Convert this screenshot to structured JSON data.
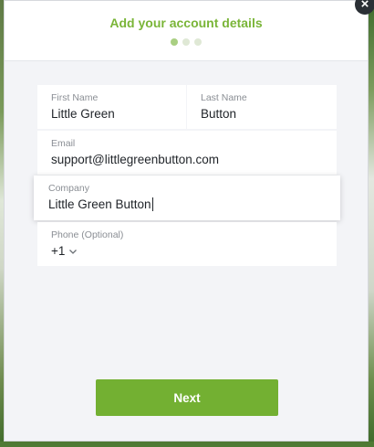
{
  "modal": {
    "title": "Add your account details",
    "steps": {
      "total": 3,
      "current": 1
    },
    "close_icon": "close-icon"
  },
  "form": {
    "first_name": {
      "label": "First Name",
      "value": "Little Green"
    },
    "last_name": {
      "label": "Last Name",
      "value": "Button"
    },
    "email": {
      "label": "Email",
      "value": "support@littlegreenbutton.com"
    },
    "company": {
      "label": "Company",
      "value": "Little Green Button"
    },
    "phone": {
      "label": "Phone (Optional)",
      "country_code": "+1"
    }
  },
  "actions": {
    "next_label": "Next"
  },
  "colors": {
    "accent": "#73b032",
    "title": "#7ab538",
    "background": "#f3f4f7",
    "step_active": "#a9cf82",
    "step_inactive": "#dfe8d5"
  }
}
